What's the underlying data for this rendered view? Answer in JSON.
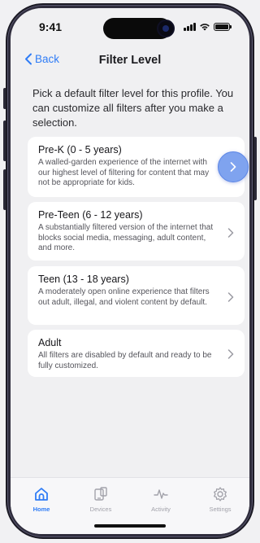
{
  "status_bar": {
    "time": "9:41"
  },
  "nav": {
    "back_label": "Back",
    "title": "Filter Level"
  },
  "intro": "Pick a default filter level for this profile. You can customize all filters after you make a selection.",
  "levels": [
    {
      "title": "Pre-K (0 - 5 years)",
      "description": "A walled-garden experience of the internet with our highest level of filtering for content that may not be appropriate for kids."
    },
    {
      "title": "Pre-Teen (6 - 12 years)",
      "description": "A substantially filtered version of the internet that blocks social media, messaging, adult content, and more."
    },
    {
      "title": "Teen (13 - 18 years)",
      "description": "A moderately open online experience that filters out adult, illegal, and violent content by default."
    },
    {
      "title": "Adult",
      "description": "All filters are disabled by default and ready to be fully customized."
    }
  ],
  "tabs": [
    {
      "label": "Home",
      "icon": "home-icon",
      "active": true
    },
    {
      "label": "Devices",
      "icon": "devices-icon",
      "active": false
    },
    {
      "label": "Activity",
      "icon": "activity-icon",
      "active": false
    },
    {
      "label": "Settings",
      "icon": "settings-icon",
      "active": false
    }
  ],
  "colors": {
    "accent": "#2f7cf6",
    "highlight": "#7fa3ef"
  }
}
